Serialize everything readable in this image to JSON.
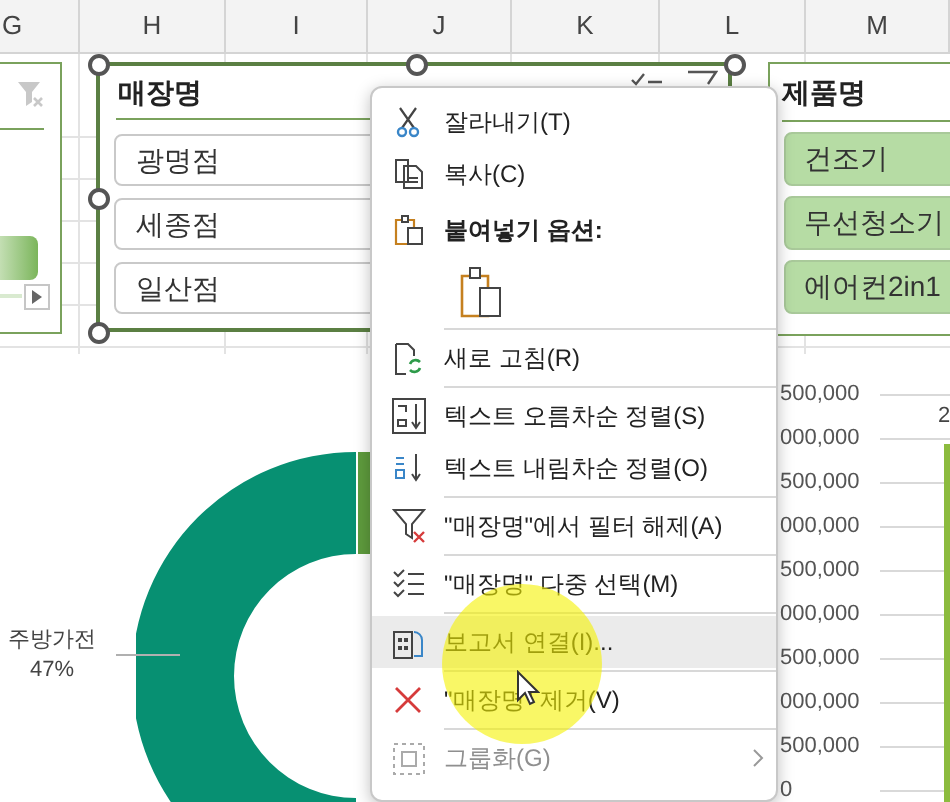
{
  "column_headers": [
    "G",
    "H",
    "I",
    "J",
    "K",
    "L",
    "M"
  ],
  "store_slicer": {
    "title": "매장명",
    "selected": true,
    "items": [
      {
        "label": "광명점",
        "selected": false
      },
      {
        "label": "세종점",
        "selected": false
      },
      {
        "label": "일산점",
        "selected": false
      }
    ]
  },
  "product_slicer": {
    "title": "제품명",
    "items": [
      {
        "label": "건조기",
        "selected": true
      },
      {
        "label": "무선청소기",
        "selected": true
      },
      {
        "label": "에어컨2in1",
        "selected": true
      }
    ]
  },
  "donut_chart": {
    "slice_label": "주방가전",
    "slice_percent": "47%"
  },
  "bar_chart": {
    "y_axis_labels": [
      "500,000",
      "000,000",
      "500,000",
      "000,000",
      "500,000",
      "000,000",
      "500,000",
      "000,000",
      "500,000",
      "0"
    ],
    "data_label": "2"
  },
  "context_menu": {
    "items": [
      {
        "kind": "item",
        "label": "잘라내기(T)",
        "highlighted": false,
        "disabled": false
      },
      {
        "kind": "item",
        "label": "복사(C)",
        "highlighted": false,
        "disabled": false
      },
      {
        "kind": "heading",
        "label": "붙여넣기 옵션:"
      },
      {
        "kind": "paste_options"
      },
      {
        "kind": "separator"
      },
      {
        "kind": "item",
        "label": "새로 고침(R)",
        "highlighted": false,
        "disabled": false
      },
      {
        "kind": "separator"
      },
      {
        "kind": "item",
        "label": "텍스트 오름차순 정렬(S)",
        "highlighted": false,
        "disabled": false
      },
      {
        "kind": "item",
        "label": "텍스트 내림차순 정렬(O)",
        "highlighted": false,
        "disabled": false
      },
      {
        "kind": "separator"
      },
      {
        "kind": "item",
        "label": "\"매장명\"에서 필터 해제(A)",
        "highlighted": false,
        "disabled": false
      },
      {
        "kind": "separator"
      },
      {
        "kind": "item",
        "label": "\"매장명\" 다중 선택(M)",
        "highlighted": false,
        "disabled": false
      },
      {
        "kind": "separator"
      },
      {
        "kind": "item",
        "label": "보고서 연결(I)...",
        "highlighted": true,
        "disabled": false
      },
      {
        "kind": "separator"
      },
      {
        "kind": "item",
        "label": "\"매장명\" 제거(V)",
        "highlighted": false,
        "disabled": false
      },
      {
        "kind": "separator"
      },
      {
        "kind": "item",
        "label": "그룹화(G)",
        "highlighted": false,
        "disabled": true,
        "submenu": true
      }
    ]
  }
}
